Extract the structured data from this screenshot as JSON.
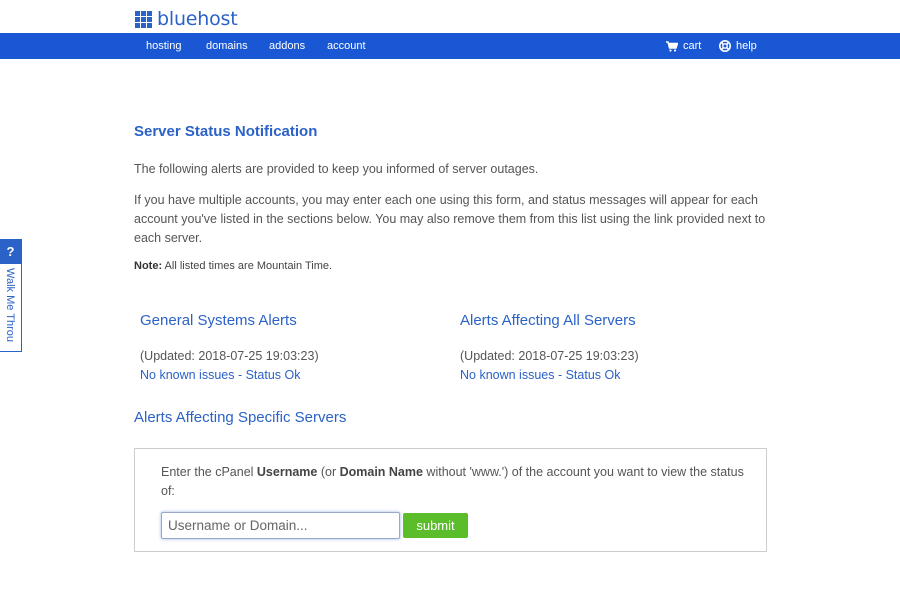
{
  "brand": {
    "name": "bluehost",
    "color": "#2b62c8"
  },
  "nav": {
    "items": [
      "hosting",
      "domains",
      "addons",
      "account"
    ],
    "cart_label": "cart",
    "help_label": "help",
    "color": "#1a57d4"
  },
  "side_tab": {
    "icon_label": "?",
    "label": "Walk Me Throu"
  },
  "page": {
    "title": "Server Status Notification",
    "intro": "The following alerts are provided to keep you informed of server outages.",
    "description": "If you have multiple accounts, you may enter each one using this form, and status messages will appear for each account you've listed in the sections below. You may also remove them from this list using the link provided next to each server.",
    "note_label": "Note:",
    "note_text": " All listed times are Mountain Time."
  },
  "alerts": {
    "general": {
      "title": "General Systems Alerts",
      "updated": "(Updated: 2018-07-25 19:03:23)",
      "status": "No known issues - Status Ok"
    },
    "all_servers": {
      "title": "Alerts Affecting All Servers",
      "updated": "(Updated: 2018-07-25 19:03:23)",
      "status": "No known issues - Status Ok"
    }
  },
  "specific": {
    "title": "Alerts Affecting Specific Servers",
    "text_1": "Enter the cPanel ",
    "username_bold": "Username",
    "text_2": " (or ",
    "domain_bold": "Domain Name",
    "text_3": " without 'www.') of the account you want to view the status of:",
    "input_placeholder": "Username or Domain...",
    "input_value": "",
    "submit_label": "submit",
    "submit_color": "#5bbd2a"
  }
}
